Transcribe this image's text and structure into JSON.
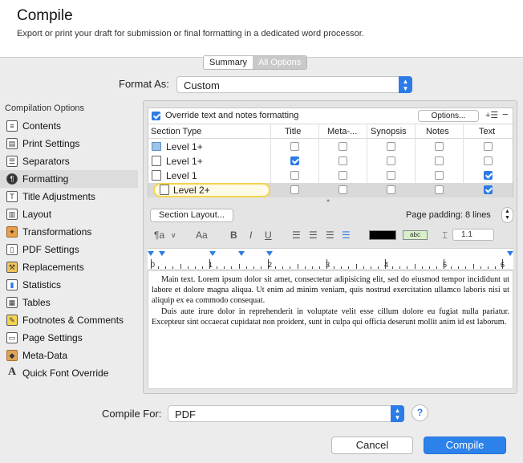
{
  "header": {
    "title": "Compile",
    "subtitle": "Export or print your draft for submission or final formatting in a dedicated word processor."
  },
  "mode_tabs": [
    "Summary",
    "All Options"
  ],
  "format_as": {
    "label": "Format As:",
    "value": "Custom"
  },
  "sidebar": {
    "title": "Compilation Options",
    "items": [
      {
        "label": "Contents",
        "icon": "contents-icon",
        "selected": false
      },
      {
        "label": "Print Settings",
        "icon": "printer-icon",
        "selected": false
      },
      {
        "label": "Separators",
        "icon": "separators-icon",
        "selected": false
      },
      {
        "label": "Formatting",
        "icon": "formatting-icon",
        "selected": true
      },
      {
        "label": "Title Adjustments",
        "icon": "title-adjustments-icon",
        "selected": false
      },
      {
        "label": "Layout",
        "icon": "layout-icon",
        "selected": false
      },
      {
        "label": "Transformations",
        "icon": "transformations-icon",
        "selected": false
      },
      {
        "label": "PDF Settings",
        "icon": "pdf-icon",
        "selected": false
      },
      {
        "label": "Replacements",
        "icon": "replacements-icon",
        "selected": false
      },
      {
        "label": "Statistics",
        "icon": "statistics-icon",
        "selected": false
      },
      {
        "label": "Tables",
        "icon": "tables-icon",
        "selected": false
      },
      {
        "label": "Footnotes & Comments",
        "icon": "footnotes-icon",
        "selected": false
      },
      {
        "label": "Page Settings",
        "icon": "page-settings-icon",
        "selected": false
      },
      {
        "label": "Meta-Data",
        "icon": "tag-icon",
        "selected": false
      },
      {
        "label": "Quick Font Override",
        "icon": "font-icon",
        "selected": false
      }
    ]
  },
  "formatting": {
    "override_label": "Override text and notes formatting",
    "override_checked": true,
    "options_button": "Options...",
    "columns": [
      "Section Type",
      "Title",
      "Meta-...",
      "Synopsis",
      "Notes",
      "Text"
    ],
    "rows": [
      {
        "label": "Level  1+",
        "icon": "folder-icon",
        "title": false,
        "meta": false,
        "synopsis": false,
        "notes": false,
        "text": false
      },
      {
        "label": "Level  1+",
        "icon": "document-stack-icon",
        "title": true,
        "meta": false,
        "synopsis": false,
        "notes": false,
        "text": false
      },
      {
        "label": "Level  1",
        "icon": "document-icon",
        "title": false,
        "meta": false,
        "synopsis": false,
        "notes": false,
        "text": true
      },
      {
        "label": "Level  2+",
        "icon": "document-icon",
        "title": false,
        "meta": false,
        "synopsis": false,
        "notes": false,
        "text": true,
        "selected": true
      }
    ],
    "section_layout_button": "Section Layout...",
    "page_padding": "Page padding: 8 lines",
    "toolbar": {
      "paragraph_style": "¶a",
      "font_size_glyph": "Aa",
      "bold": "B",
      "italic": "I",
      "underline": "U",
      "highlight_label": "abc",
      "line_spacing": "1.1"
    },
    "ruler_numbers": [
      "0",
      "1",
      "2",
      "3",
      "4",
      "5",
      "6"
    ],
    "sample_text": [
      "Main text. Lorem ipsum dolor sit amet, consectetur adipisicing elit, sed do eiusmod tempor incididunt ut labore et dolore magna aliqua. Ut enim ad minim veniam, quis nostrud exercitation ullamco laboris nisi ut aliquip ex ea commodo consequat.",
      "Duis aute irure dolor in reprehenderit in voluptate velit esse cillum dolore eu fugiat nulla pariatur. Excepteur sint occaecat cupidatat non proident, sunt in culpa qui officia deserunt mollit anim id est laborum."
    ]
  },
  "compile_for": {
    "label": "Compile For:",
    "value": "PDF"
  },
  "buttons": {
    "cancel": "Cancel",
    "compile": "Compile",
    "help": "?"
  },
  "colors": {
    "accent": "#2c7be6",
    "edit_highlight": "#f5d44f"
  }
}
